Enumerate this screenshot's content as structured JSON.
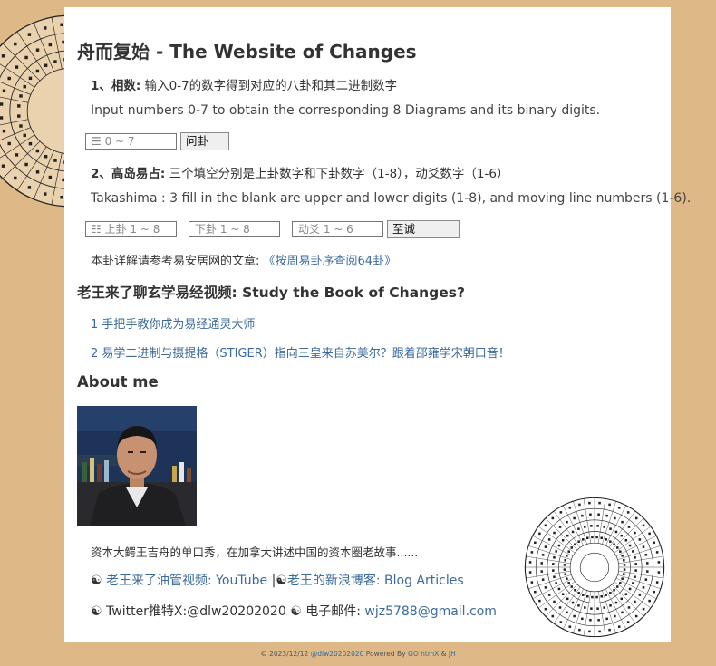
{
  "page_title": "舟而复始 - The Website of Changes",
  "section1": {
    "num": "1、",
    "head": "相数:",
    "desc": "输入0-7的数字得到对应的八卦和其二进制数字",
    "en": "Input numbers 0-7 to obtain the corresponding 8 Diagrams and its binary digits.",
    "input_placeholder": "☰  0 ~ 7",
    "button": "问卦"
  },
  "section2": {
    "num": "2、",
    "head": "高岛易占:",
    "desc": "三个填空分别是上卦数字和下卦数字（1-8），动爻数字（1-6）",
    "en": "Takashima : 3 fill in the blank are upper and lower digits (1-8), and moving line numbers (1-6).",
    "upper_placeholder": "☷ 上卦 1 ~ 8",
    "lower_placeholder": "下卦 1 ~ 8",
    "moving_placeholder": "动爻 1 ~ 6",
    "button": "至诚"
  },
  "note": {
    "text": "本卦详解请参考易安居网的文章:",
    "link": "《按周易卦序查阅64卦》"
  },
  "videos": {
    "title": "老王来了聊玄学易经视频: Study the Book of Changes?",
    "items": [
      "1 手把手教你成为易经通灵大师",
      "2 易学二进制与摄提格（STIGER）指向三皇来自苏美尔？跟着邵雍学宋朝口音！"
    ]
  },
  "about": {
    "title": "About me",
    "bio": "资本大鳄王吉舟的单口秀，在加拿大讲述中国的资本圈老故事......",
    "yinyang": "☯",
    "youtube_link": "老王来了油管视频: YouTube",
    "separator": "|",
    "blog_link": "老王的新浪博客: Blog Articles",
    "twitter": "Twitter推特X:@dlw20202020",
    "email_label": "电子邮件:",
    "email": "wjz5788@gmail.com"
  },
  "footer": {
    "copy": "© 2023/12/12",
    "handle": "@dlw20202020",
    "powered": "Powered By",
    "tech": "GO htmX",
    "amp": "&",
    "author": "JH"
  },
  "colors": {
    "background": "#deb887",
    "link": "#3b6a9b",
    "card": "#ffffff"
  }
}
